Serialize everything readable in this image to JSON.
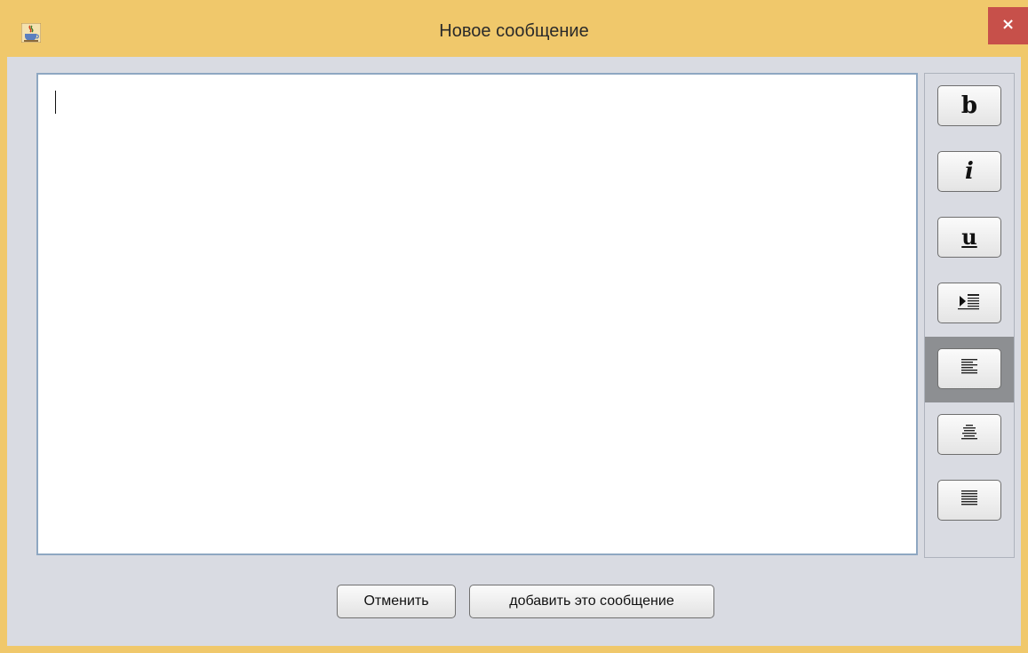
{
  "window": {
    "title": "Новое сообщение",
    "close_label": "×",
    "app_icon": "java-coffee-cup-icon"
  },
  "editor": {
    "value": ""
  },
  "toolbar": {
    "buttons": [
      {
        "name": "bold",
        "label": "b"
      },
      {
        "name": "italic",
        "label": "i"
      },
      {
        "name": "underline",
        "label": "u"
      },
      {
        "name": "indent",
        "icon": "indent-icon"
      },
      {
        "name": "align-left",
        "icon": "align-left-icon",
        "selected": true
      },
      {
        "name": "align-center",
        "icon": "align-center-icon"
      },
      {
        "name": "align-right",
        "icon": "align-right-icon"
      }
    ]
  },
  "footer": {
    "cancel_label": "Отменить",
    "add_label": "добавить это сообщение"
  },
  "colors": {
    "title_bar": "#f0c86b",
    "client_bg": "#d9dbe2",
    "close_button": "#c7504a",
    "selected_tool": "#8d8f92"
  }
}
